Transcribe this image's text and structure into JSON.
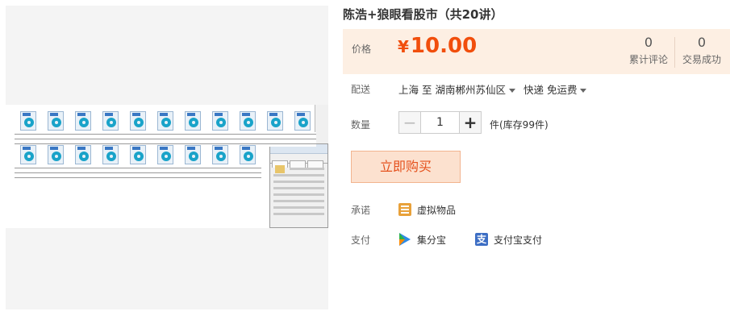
{
  "product": {
    "title": "陈浩+狼眼看股市（共20讲）"
  },
  "price": {
    "label": "价格",
    "currency": "¥",
    "amount": "10.00"
  },
  "stats": {
    "reviews_count": "0",
    "reviews_label": "累计评论",
    "sales_count": "0",
    "sales_label": "交易成功"
  },
  "shipping": {
    "label": "配送",
    "from": "上海",
    "to_word": "至",
    "destination": "湖南郴州苏仙区",
    "method": "快递 免运费"
  },
  "quantity": {
    "label": "数量",
    "value": "1",
    "minus": "−",
    "plus": "+",
    "stock": "件(库存99件)"
  },
  "buy_button": "立即购买",
  "promise": {
    "label": "承诺",
    "item": "虚拟物品"
  },
  "payment": {
    "label": "支付",
    "methods": [
      "集分宝",
      "支付宝支付"
    ],
    "alipay_glyph": "支"
  },
  "colors": {
    "price": "#f14e0c",
    "price_bg": "#fdefe3",
    "buy_bg": "#fce1cf",
    "buy_text": "#e5511d"
  }
}
